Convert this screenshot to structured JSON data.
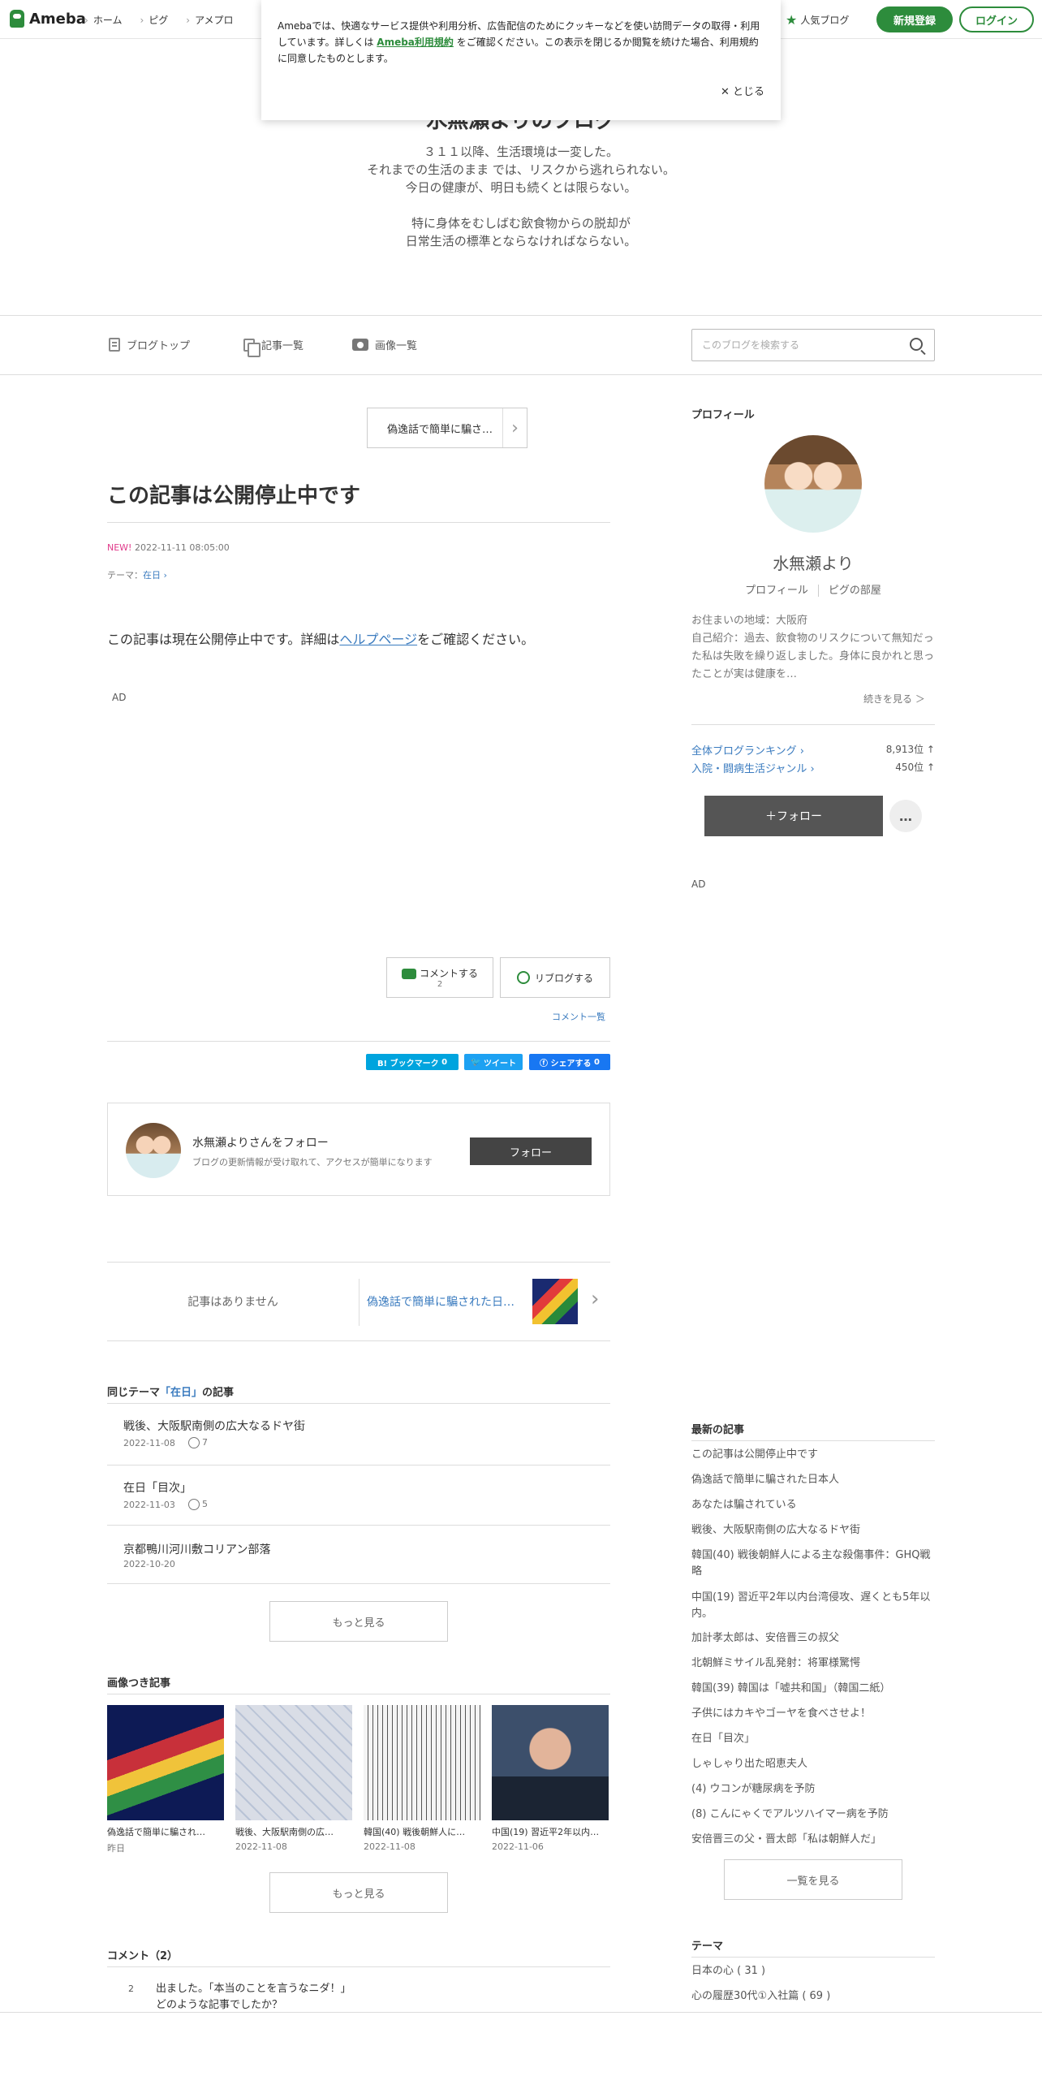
{
  "topbar": {
    "logo": "Ameba",
    "nav": [
      "ホーム",
      "ピグ",
      "アメプロ"
    ],
    "popular_blog": "人気ブログ",
    "register": "新規登録",
    "login": "ログイン"
  },
  "cookie": {
    "text1": "Amebaでは、快適なサービス提供や利用分析、広告配信のためにクッキーなどを使い訪問データの取得・利用しています。詳しくは",
    "link": "Ameba利用規約",
    "text2": "をご確認ください。この表示を閉じるか閲覧を続けた場合、利用規約に同意したものとします。",
    "close": "とじる"
  },
  "header": {
    "title": "水無瀬よりのブログ",
    "description": "３１１以降、生活環境は一変した。\nそれまでの生活のまま では、リスクから逃れられない。\n今日の健康が、明日も続くとは限らない。\n\n特に身体をむしばむ飲食物からの脱却が\n日常生活の標準とならなければならない。"
  },
  "subnav": {
    "items": [
      "ブログトップ",
      "記事一覧",
      "画像一覧"
    ],
    "search_placeholder": "このブログを検索する"
  },
  "article": {
    "next_label": "偽逸話で簡単に騙さ…",
    "title": "この記事は公開停止中です",
    "new_badge": "NEW!",
    "date": "2022-11-11 08:05:00",
    "theme_prefix": "テーマ：",
    "theme": "在日",
    "body1": "この記事は現在公開停止中です。詳細は",
    "body_link": "ヘルプページ",
    "body2": "をご確認ください。",
    "ad": "AD"
  },
  "actions": {
    "comment": "コメントする",
    "comment_count": "2",
    "reblog": "リブログする",
    "comment_list": "コメント一覧"
  },
  "share": {
    "bookmark": "B! ブックマーク",
    "bookmark_count": "0",
    "tweet": "ツイート",
    "facebook": "シェアする",
    "facebook_count": "0"
  },
  "follow_card": {
    "name": "水無瀬よりさんをフォロー",
    "sub": "ブログの更新情報が受け取れて、アクセスが簡単になります",
    "button": "フォロー"
  },
  "pager": {
    "none": "記事はありません",
    "next": "偽逸話で簡単に騙された日…"
  },
  "same_theme": {
    "heading_prefix": "同じテーマ",
    "heading_theme": "「在日」",
    "heading_suffix": "の記事",
    "items": [
      {
        "title": "戦後、大阪駅南側の広大なるドヤ街",
        "date": "2022-11-08",
        "likes": "7"
      },
      {
        "title": "在日「目次」",
        "date": "2022-11-03",
        "likes": "5"
      },
      {
        "title": "京都鴨川河川敷コリアン部落",
        "date": "2022-10-20",
        "likes": ""
      }
    ],
    "more": "もっと見る"
  },
  "image_articles": {
    "heading": "画像つき記事",
    "items": [
      {
        "caption": "偽逸話で簡単に騙され…",
        "date": "昨日"
      },
      {
        "caption": "戦後、大阪駅南側の広…",
        "date": "2022-11-08"
      },
      {
        "caption": "韓国(40) 戦後朝鮮人に…",
        "date": "2022-11-08"
      },
      {
        "caption": "中国(19) 習近平2年以内…",
        "date": "2022-11-06"
      }
    ],
    "more": "もっと見る"
  },
  "comments": {
    "heading": "コメント（2）",
    "items": [
      {
        "num": "2",
        "line1": "出ました。「本当のことを言うなニダ！」",
        "line2": "どのような記事でしたか？"
      }
    ]
  },
  "sidebar": {
    "profile_heading": "プロフィール",
    "name": "水無瀬より",
    "links": [
      "プロフィール",
      "ピグの部屋"
    ],
    "text": "お住まいの地域：大阪府\n自己紹介：過去、飲食物のリスクについて無知だった私は失敗を繰り返しました。身体に良かれと思ったことが実は健康を…",
    "more": "続きを見る ＞",
    "rankings": [
      {
        "label": "全体ブログランキング",
        "value": "8,913位 ↑"
      },
      {
        "label": "入院・闘病生活ジャンル",
        "value": "450位 ↑"
      }
    ],
    "follow": "＋フォロー",
    "dots": "…",
    "ad": "AD",
    "recent_heading": "最新の記事",
    "recent": [
      "この記事は公開停止中です",
      "偽逸話で簡単に騙された日本人",
      "あなたは騙されている",
      "戦後、大阪駅南側の広大なるドヤ街",
      "韓国(40) 戦後朝鮮人による主な殺傷事件：GHQ戦略",
      "中国(19) 習近平2年以内台湾侵攻、遅くとも5年以内。",
      "加計孝太郎は、安倍晋三の叔父",
      "北朝鮮ミサイル乱発射：将軍様驚愕",
      "韓国(39) 韓国は「嘘共和国」（韓国二紙）",
      "子供にはカキやゴーヤを食べさせよ！",
      "在日「目次」",
      "しゃしゃり出た昭恵夫人",
      "(4) ウコンが糖尿病を予防",
      "(8) こんにゃくでアルツハイマー病を予防",
      "安倍晋三の父・晋太郎「私は朝鮮人だ」"
    ],
    "list_button": "一覧を見る",
    "theme_heading": "テーマ",
    "themes": [
      "日本の心 ( 31 )",
      "心の履歴30代①入社篇 ( 69 )"
    ]
  }
}
